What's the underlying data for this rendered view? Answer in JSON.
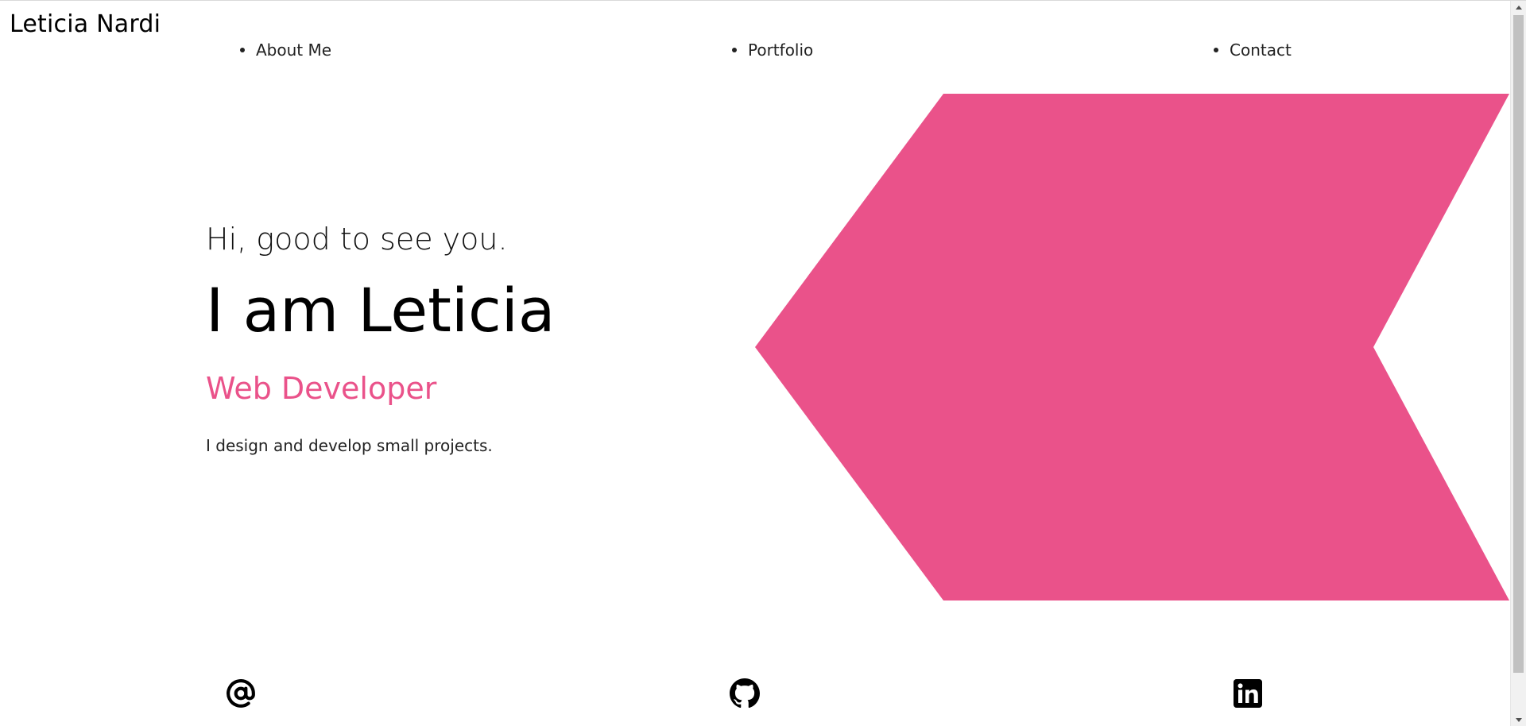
{
  "brand": {
    "name": "Leticia Nardi"
  },
  "nav": {
    "items": [
      {
        "label": "About Me"
      },
      {
        "label": "Portfolio"
      },
      {
        "label": "Contact"
      }
    ]
  },
  "hero": {
    "greeting": "Hi, good to see you.",
    "headline": "I am Leticia",
    "role": "Web Developer",
    "blurb": "I design and develop small projects."
  },
  "socials": {
    "items": [
      {
        "icon": "at-sign-icon"
      },
      {
        "icon": "github-icon"
      },
      {
        "icon": "linkedin-icon"
      }
    ]
  },
  "colors": {
    "accent": "#EA528A",
    "text": "#000000",
    "background": "#FFFFFF"
  }
}
